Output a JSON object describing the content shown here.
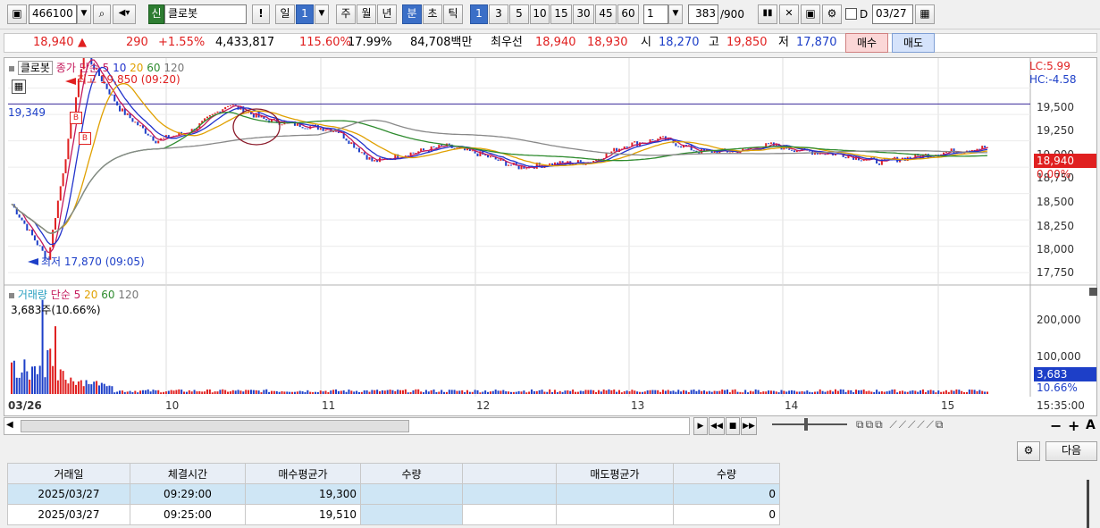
{
  "toolbar": {
    "code": "466100",
    "stock_badge": "신",
    "stock_name": "클로봇",
    "period_buttons": [
      "일",
      "1",
      "주",
      "월",
      "년",
      "분",
      "초",
      "틱",
      "1",
      "3",
      "5",
      "10",
      "15",
      "30",
      "45",
      "60"
    ],
    "multiplier": "1",
    "count": "383",
    "count_total": "/900",
    "d_label": "D",
    "date": "03/27"
  },
  "quote": {
    "price": "18,940",
    "arrow": "▲",
    "change": "290",
    "change_pct": "+1.55%",
    "volume": "4,433,817",
    "vol_ratio": "115.60%",
    "turnover": "17.99%",
    "amount": "84,708백만",
    "best_label": "최우선",
    "best_ask": "18,940",
    "best_bid": "18,930",
    "open_label": "시",
    "open": "18,270",
    "high_label": "고",
    "high": "19,850",
    "low_label": "저",
    "low": "17,870",
    "buy_btn": "매수",
    "sell_btn": "매도"
  },
  "price_chart": {
    "legend_name": "클로봇",
    "legend_close": "종가",
    "legend_ma": "단순 5",
    "legend_periods": [
      "10",
      "20",
      "60",
      "120"
    ],
    "high_annot": "최고 19,850 (09:20)",
    "low_annot": "최저 17,870 (09:05)",
    "hline_label": "19,349",
    "lc_label": "LC:5.99",
    "hc_label": "HC:-4.58",
    "price_tag": "18,940",
    "pct_tag": "0.00%",
    "y_ticks": [
      "19,500",
      "19,250",
      "19,000",
      "18,750",
      "18,500",
      "18,250",
      "18,000",
      "17,750"
    ],
    "marker_b": "B"
  },
  "volume_chart": {
    "legend_name": "거래량",
    "legend_ma": "단순 5",
    "legend_periods": [
      "20",
      "60",
      "120"
    ],
    "info": "3,683주(10.66%)",
    "y_ticks": [
      "200,000",
      "100,000"
    ],
    "vol_tag": "3,683",
    "vol_pct_tag": "10.66%"
  },
  "x_axis": {
    "labels": [
      "03/26",
      "10",
      "11",
      "12",
      "13",
      "14",
      "15"
    ],
    "end_time": "15:35:00"
  },
  "bottom": {
    "next_btn": "다음"
  },
  "trades": {
    "headers": [
      "거래일",
      "체결시간",
      "매수평균가",
      "수량",
      "",
      "매도평균가",
      "수량"
    ],
    "rows": [
      [
        "2025/03/27",
        "09:29:00",
        "19,300",
        "",
        "",
        "",
        "0"
      ],
      [
        "2025/03/27",
        "09:25:00",
        "19,510",
        "",
        "",
        "",
        "0"
      ]
    ]
  },
  "chart_data": {
    "type": "line",
    "title": "",
    "x": [
      "03/26 09:00",
      "03/26 10:00",
      "03/26 11:00",
      "03/26 12:00",
      "03/26 13:00",
      "03/26 14:00",
      "03/26 15:00",
      "03/26 15:35"
    ],
    "series": [
      {
        "name": "종가",
        "values": [
          18400,
          19300,
          19150,
          18800,
          18780,
          18840,
          18850,
          18940
        ]
      }
    ],
    "ylim": [
      17700,
      19700
    ],
    "xlabel": "",
    "ylabel": ""
  }
}
